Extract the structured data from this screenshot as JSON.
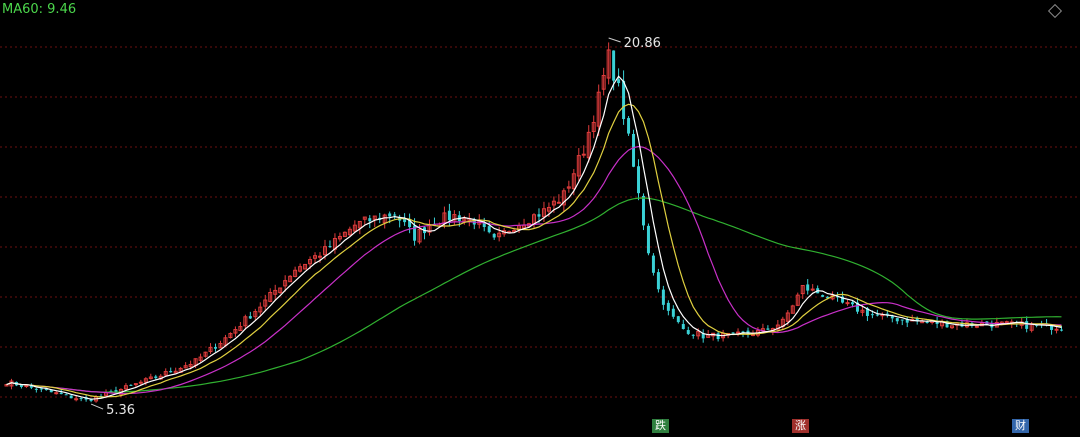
{
  "chart_data": {
    "type": "candlestick",
    "indicator_label": "MA60: 9.46",
    "max_label": "20.86",
    "min_label": "5.36",
    "ylim": [
      5.0,
      22.0
    ],
    "grid": true,
    "badges": [
      "跌",
      "涨",
      "财"
    ],
    "colors": {
      "background": "#000000",
      "grid": "#6b1010",
      "up": "#e03c3c",
      "down": "#3ad1d6",
      "ma_white": "#ffffff",
      "ma_yellow": "#e0d040",
      "ma_magenta": "#c830c8",
      "ma60_green": "#30b030"
    },
    "close_anchors": [
      [
        0,
        6.3
      ],
      [
        6,
        6.0
      ],
      [
        12,
        5.7
      ],
      [
        16,
        5.5
      ],
      [
        22,
        5.9
      ],
      [
        30,
        6.5
      ],
      [
        38,
        7.2
      ],
      [
        44,
        8.2
      ],
      [
        52,
        9.8
      ],
      [
        58,
        11.2
      ],
      [
        64,
        12.0
      ],
      [
        70,
        13.1
      ],
      [
        74,
        13.4
      ],
      [
        78,
        13.6
      ],
      [
        82,
        12.6
      ],
      [
        86,
        13.3
      ],
      [
        90,
        13.5
      ],
      [
        94,
        13.3
      ],
      [
        98,
        12.4
      ],
      [
        102,
        13.1
      ],
      [
        108,
        13.7
      ],
      [
        112,
        14.4
      ],
      [
        116,
        16.4
      ],
      [
        119,
        18.6
      ],
      [
        121,
        20.4
      ],
      [
        123,
        19.0
      ],
      [
        125,
        16.8
      ],
      [
        127,
        14.4
      ],
      [
        129,
        12.0
      ],
      [
        131,
        10.3
      ],
      [
        133,
        9.3
      ],
      [
        136,
        8.6
      ],
      [
        140,
        8.3
      ],
      [
        146,
        8.3
      ],
      [
        152,
        8.5
      ],
      [
        156,
        8.9
      ],
      [
        160,
        10.4
      ],
      [
        164,
        10.1
      ],
      [
        168,
        9.7
      ],
      [
        174,
        9.2
      ],
      [
        180,
        9.0
      ],
      [
        190,
        8.8
      ],
      [
        200,
        8.8
      ],
      [
        210,
        8.7
      ],
      [
        212,
        8.7
      ]
    ]
  }
}
